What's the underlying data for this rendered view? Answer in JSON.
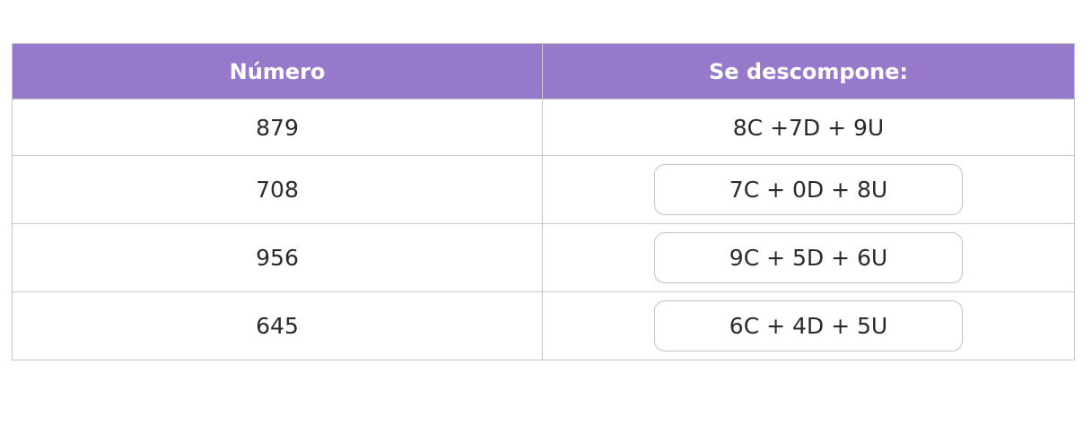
{
  "table": {
    "headers": {
      "numero": "Número",
      "descompone": "Se descompone:"
    },
    "rows": [
      {
        "numero": "879",
        "descomposicion": "8C +7D + 9U",
        "boxed": false
      },
      {
        "numero": "708",
        "descomposicion": "7C + 0D + 8U",
        "boxed": true
      },
      {
        "numero": "956",
        "descomposicion": "9C + 5D + 6U",
        "boxed": true
      },
      {
        "numero": "645",
        "descomposicion": "6C + 4D + 5U",
        "boxed": true
      }
    ]
  },
  "colors": {
    "header_bg": "#9679cb",
    "header_text": "#ffffff",
    "border": "#c8c8c8"
  }
}
